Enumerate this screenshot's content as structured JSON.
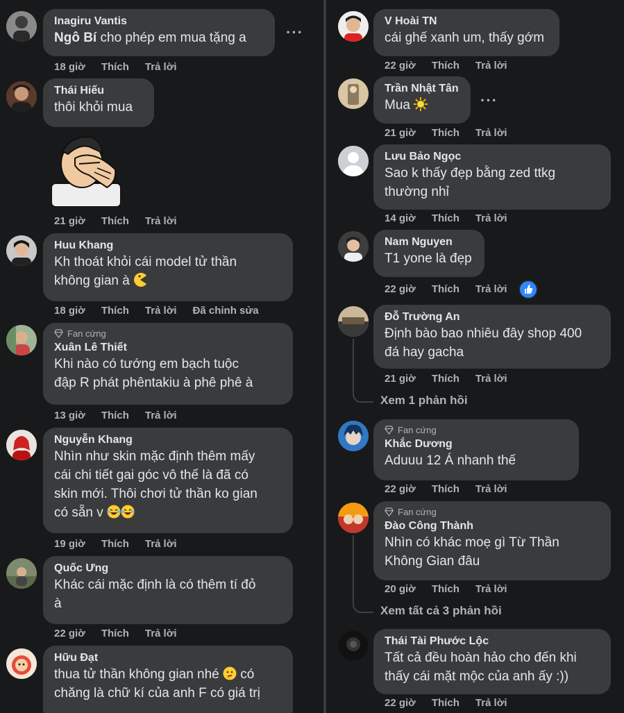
{
  "left": [
    {
      "author": "Inagiru Vantis",
      "tag": "Ngô Bí",
      "text": " cho phép em mua tặng a",
      "time": "18 giờ",
      "like": "Thích",
      "reply": "Trả lời",
      "more": "···"
    },
    {
      "author": "Thái Hiếu",
      "text": "thôi khỏi mua",
      "time": "21 giờ",
      "like": "Thích",
      "reply": "Trả lời",
      "sticker": "facepalm-sticker"
    },
    {
      "author": "Huu Khang",
      "line1": "Kh thoát khỏi cái model tử thần",
      "line2": "không gian à",
      "time": "18 giờ",
      "like": "Thích",
      "reply": "Trả lời",
      "edited": "Đã chỉnh sửa"
    },
    {
      "badge": "Fan cứng",
      "author": "Xuân Lê Thiết",
      "line1": "Khi nào có tướng em bạch tuộc",
      "line2": "đập R phát phêntakiu à phê phê à",
      "time": "13 giờ",
      "like": "Thích",
      "reply": "Trả lời"
    },
    {
      "author": "Nguyễn Khang",
      "line1": "Nhìn như skin mặc định thêm mấy",
      "line2": "cái chi tiết gai góc vô thế là đã có",
      "line3": "skin mới. Thôi chơi tử thần ko gian",
      "line4": "có sẵn v",
      "time": "19 giờ",
      "like": "Thích",
      "reply": "Trả lời"
    },
    {
      "author": "Quốc Ưng",
      "line1": "Khác cái mặc định là có thêm tí đỏ",
      "line2": "à",
      "time": "22 giờ",
      "like": "Thích",
      "reply": "Trả lời"
    },
    {
      "author": "Hữu Đạt",
      "line1": "thua tử thần không gian nhé",
      "line1b": " có",
      "line2": "chăng là chữ kí của anh F có giá trị"
    }
  ],
  "right": [
    {
      "author": "V Hoài TN",
      "text": "cái ghế xanh um, thấy gớm",
      "time": "22 giờ",
      "like": "Thích",
      "reply": "Trả lời"
    },
    {
      "author": "Trần Nhật Tân",
      "text": "Mua",
      "time": "21 giờ",
      "like": "Thích",
      "reply": "Trả lời",
      "more": "···"
    },
    {
      "author": "Lưu Bảo Ngọc",
      "line1": "Sao k thấy đẹp bằng zed ttkg",
      "line2": "thường nhỉ",
      "time": "14 giờ",
      "like": "Thích",
      "reply": "Trả lời"
    },
    {
      "author": "Nam Nguyen",
      "text": "T1 yone là đẹp",
      "time": "22 giờ",
      "like": "Thích",
      "reply": "Trả lời"
    },
    {
      "author": "Đỗ Trường An",
      "line1": "Định bào bao nhiêu đây shop 400",
      "line2": "đá hay gacha",
      "time": "21 giờ",
      "like": "Thích",
      "reply": "Trả lời",
      "replies": "Xem 1 phản hồi"
    },
    {
      "badge": "Fan cứng",
      "author": "Khắc Dương",
      "text": "Aduuu 12 Á nhanh thế",
      "time": "22 giờ",
      "like": "Thích",
      "reply": "Trả lời"
    },
    {
      "badge": "Fan cứng",
      "author": "Đào Công Thành",
      "line1": "Nhìn có khác moẹ gì Từ Thần",
      "line2": "Không Gian đâu",
      "time": "20 giờ",
      "like": "Thích",
      "reply": "Trả lời",
      "replies": "Xem tất cả 3 phản hồi"
    },
    {
      "author": "Thái Tài Phước Lộc",
      "line1": "Tất cả đều hoàn hảo cho đến khi",
      "line2": "thấy cái mặt mộc của anh ấy :))",
      "time": "22 giờ",
      "like": "Thích",
      "reply": "Trả lời"
    }
  ],
  "colors": {
    "background": "#18191a",
    "bubble": "#3a3b3c",
    "text": "#e4e6eb",
    "meta": "#b0b3b8",
    "like": "#2d88ff"
  }
}
